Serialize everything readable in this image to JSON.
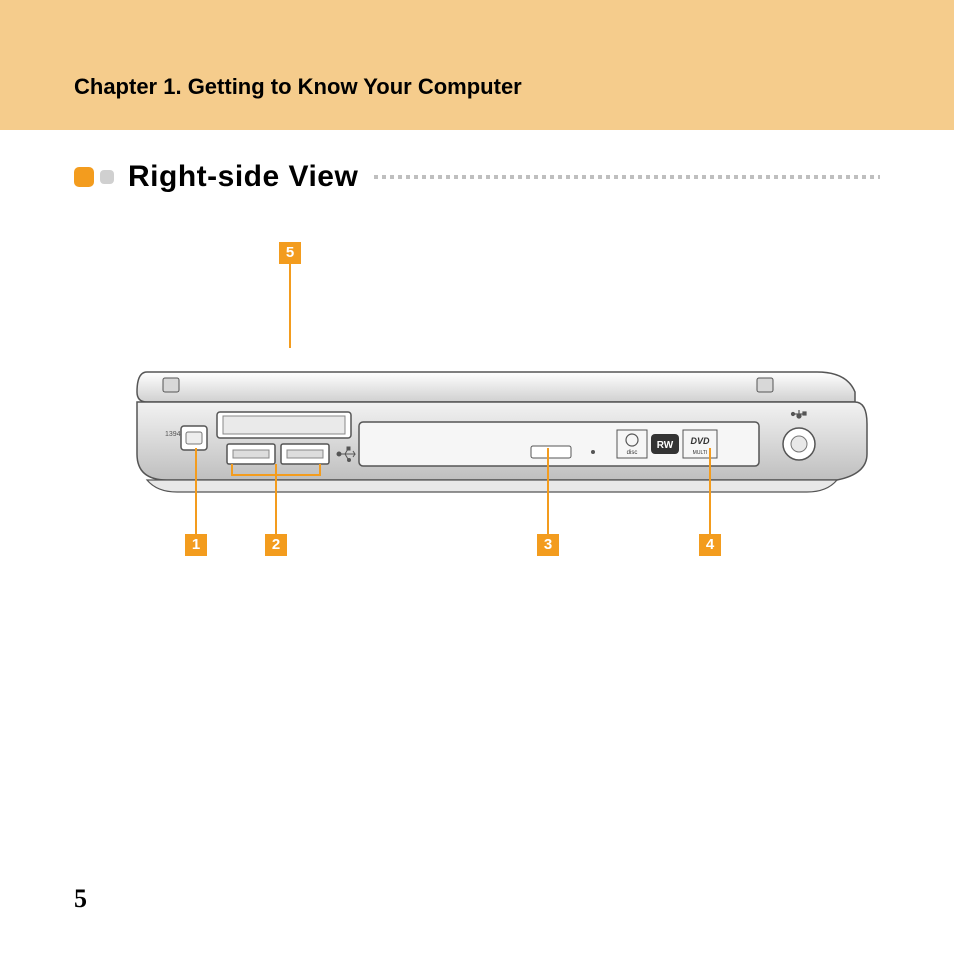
{
  "header": {
    "chapter_title": "Chapter 1. Getting to Know Your Computer"
  },
  "section": {
    "title": "Right-side View"
  },
  "callouts": {
    "c1": "1",
    "c2": "2",
    "c3": "3",
    "c4": "4",
    "c5": "5"
  },
  "page_number": "5"
}
